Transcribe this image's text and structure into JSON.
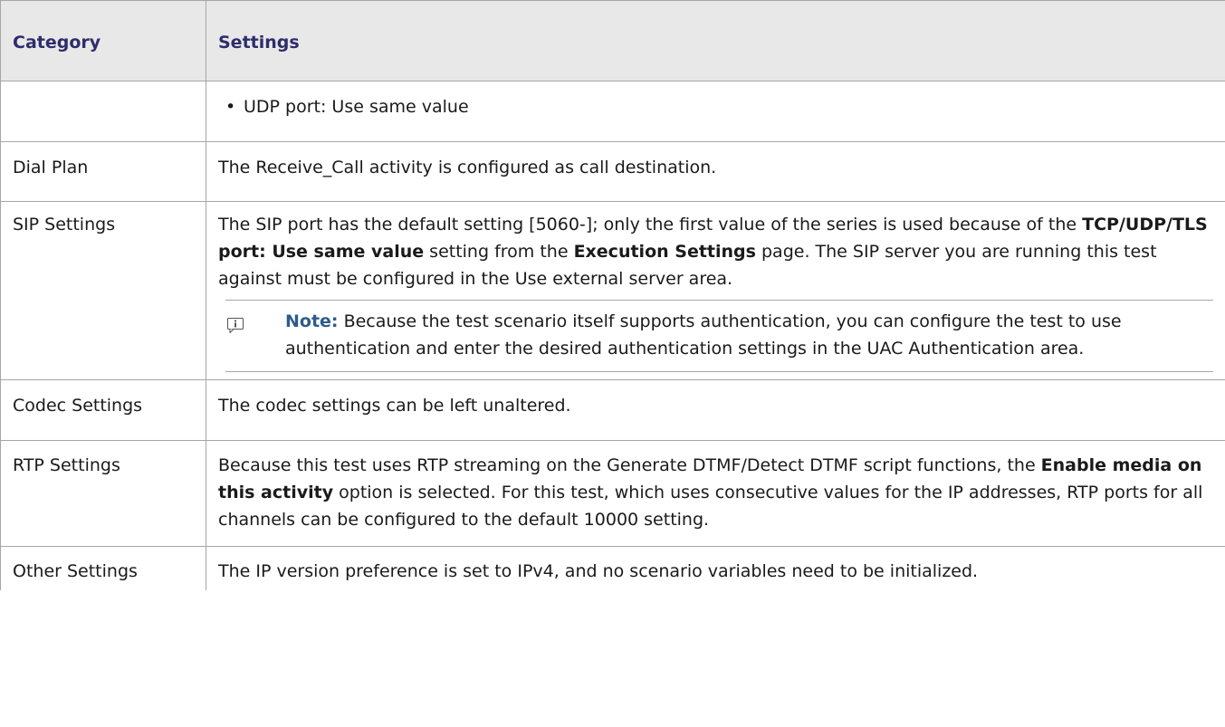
{
  "headers": {
    "category": "Category",
    "settings": "Settings"
  },
  "continuation": {
    "bullet": "•",
    "text": "UDP port: Use same value"
  },
  "dial_plan": {
    "category": "Dial Plan",
    "text": "The Receive_Call activity is configured as call destination."
  },
  "sip": {
    "category": "SIP Settings",
    "t1": "The SIP port has the default setting [5060-]; only the first value of the series is used because of the ",
    "b1": "TCP/UDP/TLS port: Use same value",
    "t2": " setting from the ",
    "b2": "Execution Settings",
    "t3": " page. The SIP server you are running this test against must be configured in the Use external server area.",
    "note_label": "Note:",
    "note_text": " Because the test scenario itself supports authentication, you can configure the test to use authentication and enter the desired authentication settings in the UAC Authentication area."
  },
  "codec": {
    "category": "Codec Settings",
    "text": "The codec settings can be left unaltered."
  },
  "rtp": {
    "category": "RTP Settings",
    "t1": "Because this test uses RTP streaming on the Generate DTMF/Detect DTMF script functions, the ",
    "b1": "Enable media on this activity",
    "t2": " option is selected. For this test, which uses consecutive values for the IP addresses, RTP ports for all channels can be configured to the default 10000 setting."
  },
  "other": {
    "category": "Other Settings",
    "text": "The IP version preference is set to IPv4, and no scenario variables need to be initialized."
  },
  "colors": {
    "header_bg": "#e8e8e8",
    "header_text": "#2e2d6b",
    "note_label": "#2e5c8a",
    "border": "#a6a6a6"
  },
  "icons": {
    "note": "info-icon"
  }
}
